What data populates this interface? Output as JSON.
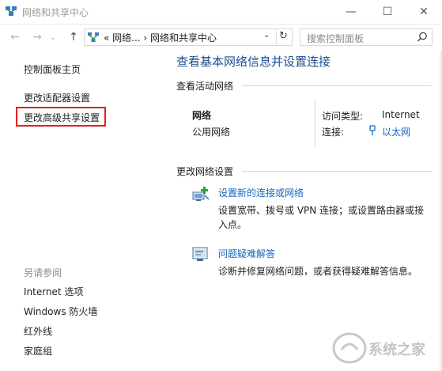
{
  "window": {
    "title": "网络和共享中心",
    "controls": {
      "minimize": "—",
      "maximize": "☐",
      "close": "✕"
    }
  },
  "nav": {
    "back": "←",
    "forward": "→",
    "dropdown": "⌄",
    "up": "↑",
    "address_text": "« 网络... › 网络和共享中心",
    "address_dropdown": "⌄",
    "refresh": "↻",
    "search_placeholder": "搜索控制面板"
  },
  "sidebar": {
    "links": [
      {
        "label": "控制面板主页"
      },
      {
        "label": "更改适配器设置"
      },
      {
        "label": "更改高级共享设置"
      }
    ],
    "see_also_title": "另请参阅",
    "see_also": [
      {
        "label": "Internet 选项"
      },
      {
        "label": "Windows 防火墙"
      },
      {
        "label": "红外线"
      },
      {
        "label": "家庭组"
      }
    ]
  },
  "main": {
    "title": "查看基本网络信息并设置连接",
    "active_section": "查看活动网络",
    "network_name": "网络",
    "network_type": "公用网络",
    "access_type_label": "访问类型:",
    "access_type_value": "Internet",
    "connection_label": "连接:",
    "connection_value": "以太网",
    "change_section": "更改网络设置",
    "tasks": [
      {
        "title": "设置新的连接或网络",
        "desc_line1": "设置宽带、拨号或 VPN 连接；或设置路由器或接",
        "desc_line2": "入点。"
      },
      {
        "title": "问题疑难解答",
        "desc_line1": "诊断并修复网络问题，或者获得疑难解答信息。"
      }
    ]
  },
  "watermark": {
    "text": "系统之家"
  },
  "colors": {
    "accent_title": "#1d4f91",
    "link": "#1565c0",
    "highlight_box": "#e02020"
  }
}
